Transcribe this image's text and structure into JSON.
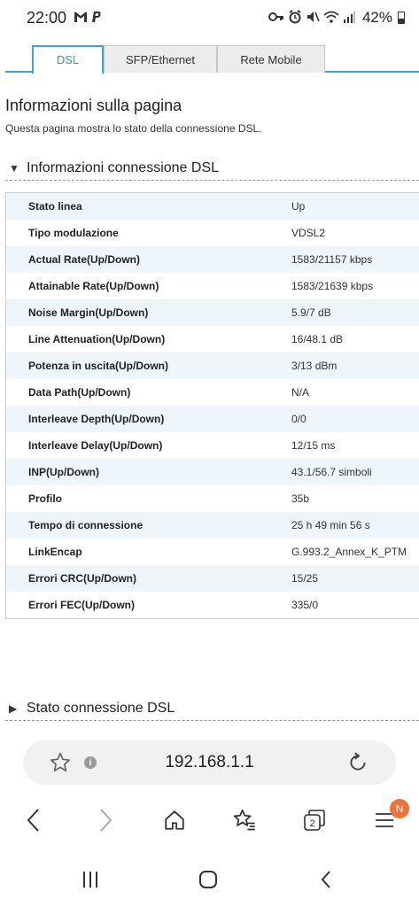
{
  "status_bar": {
    "time": "22:00",
    "left_icons": [
      "gmail-icon",
      "paypal-icon"
    ],
    "right_icons": [
      "key-icon",
      "alarm-icon",
      "mute-icon",
      "wifi-icon",
      "signal-icon"
    ],
    "battery": "42%"
  },
  "tabs": [
    {
      "label": "DSL",
      "active": true
    },
    {
      "label": "SFP/Ethernet",
      "active": false
    },
    {
      "label": "Rete Mobile",
      "active": false
    }
  ],
  "page": {
    "title": "Informazioni sulla pagina",
    "description": "Questa pagina mostra lo stato della connessione DSL."
  },
  "section_info": {
    "title": "Informazioni connessione DSL",
    "expanded": true
  },
  "table": {
    "rows": [
      {
        "label": "Stato linea",
        "value": "Up"
      },
      {
        "label": "Tipo modulazione",
        "value": "VDSL2"
      },
      {
        "label": "Actual Rate(Up/Down)",
        "value": "1583/21157 kbps"
      },
      {
        "label": "Attainable Rate(Up/Down)",
        "value": "1583/21639 kbps"
      },
      {
        "label": "Noise Margin(Up/Down)",
        "value": "5.9/7 dB"
      },
      {
        "label": "Line Attenuation(Up/Down)",
        "value": "16/48.1 dB"
      },
      {
        "label": "Potenza in uscita(Up/Down)",
        "value": "3/13 dBm"
      },
      {
        "label": "Data Path(Up/Down)",
        "value": "N/A"
      },
      {
        "label": "Interleave Depth(Up/Down)",
        "value": "0/0"
      },
      {
        "label": "Interleave Delay(Up/Down)",
        "value": "12/15 ms"
      },
      {
        "label": "INP(Up/Down)",
        "value": "43.1/56.7 simboli"
      },
      {
        "label": "Profilo",
        "value": "35b"
      },
      {
        "label": "Tempo di connessione",
        "value": "25 h 49 min 56 s"
      },
      {
        "label": "LinkEncap",
        "value": "G.993.2_Annex_K_PTM"
      },
      {
        "label": "Errori CRC(Up/Down)",
        "value": "15/25"
      },
      {
        "label": "Errori FEC(Up/Down)",
        "value": "335/0"
      }
    ]
  },
  "section_status": {
    "title": "Stato connessione DSL",
    "expanded": false
  },
  "browser": {
    "url": "192.168.1.1",
    "tab_count": "2",
    "menu_badge": "N",
    "accent": "#3da3d8",
    "badge_color": "#f26e3a"
  }
}
